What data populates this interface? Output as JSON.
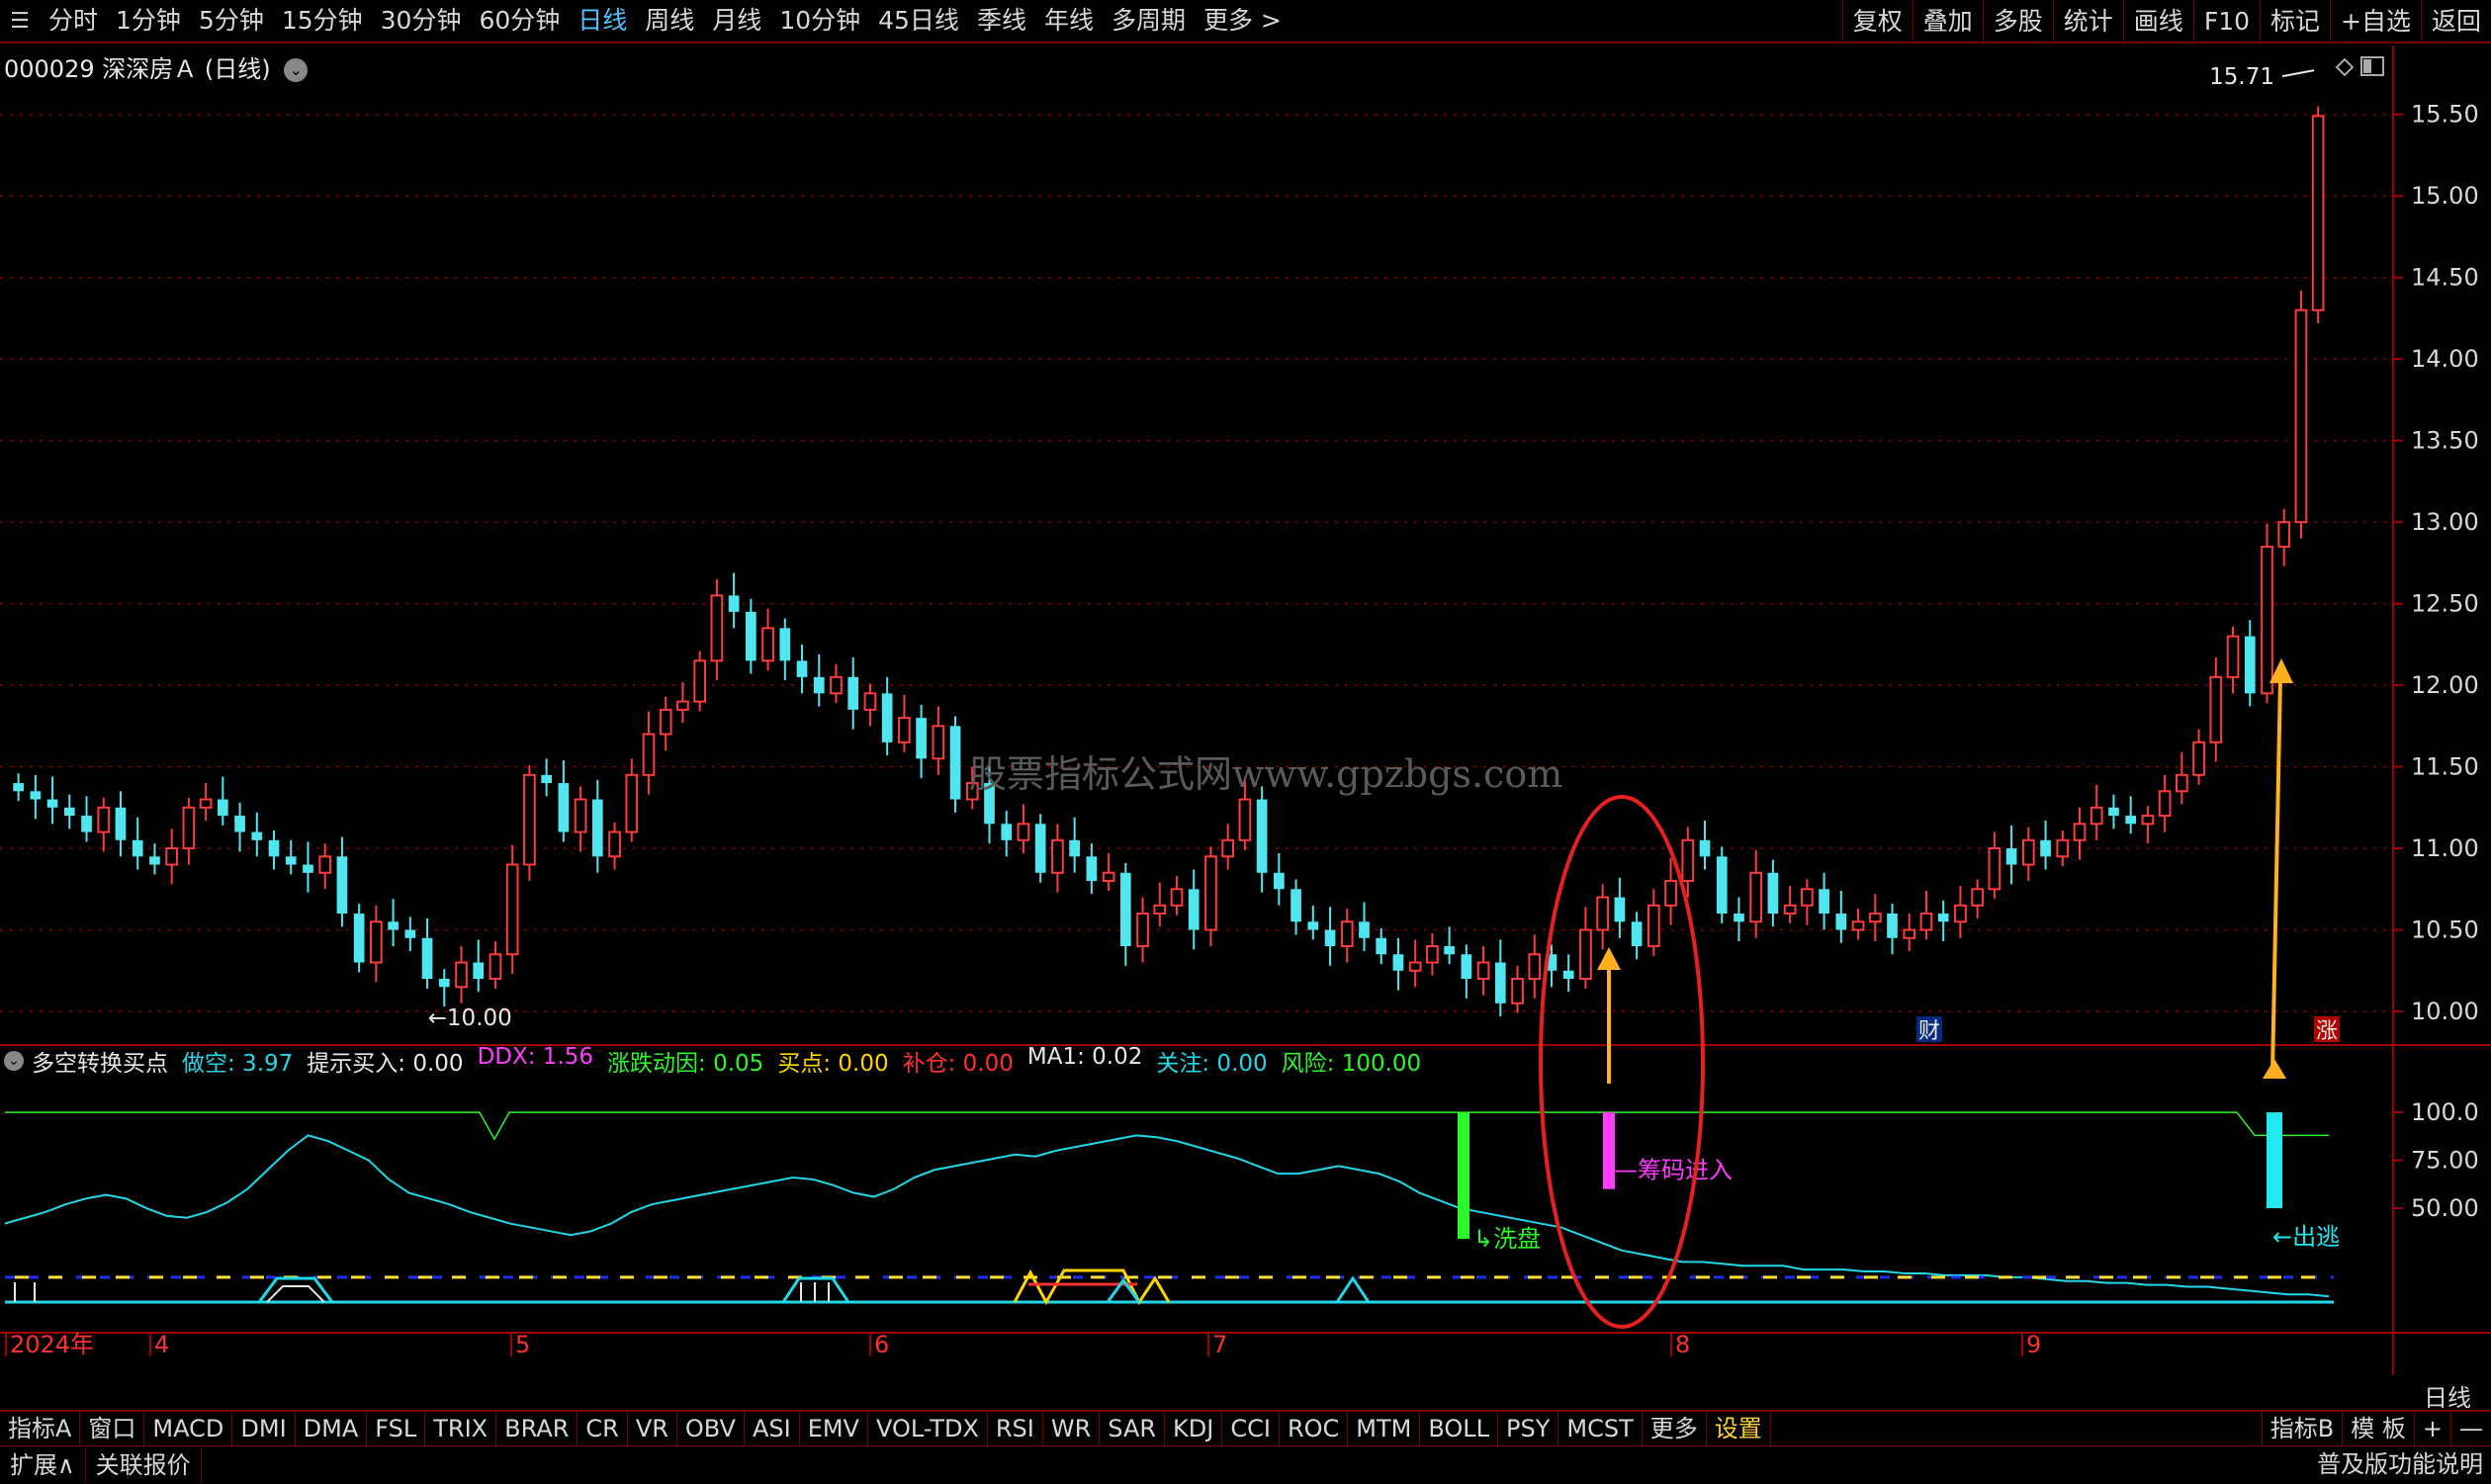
{
  "toolbar": {
    "menu_icon": "☰",
    "periods": [
      "分时",
      "1分钟",
      "5分钟",
      "15分钟",
      "30分钟",
      "60分钟",
      "日线",
      "周线",
      "月线",
      "10分钟",
      "45日线",
      "季线",
      "年线",
      "多周期",
      "更多 >"
    ],
    "active_period": "日线",
    "right_items": [
      "复权",
      "叠加",
      "多股",
      "统计",
      "画线",
      "F10",
      "标记",
      "+自选",
      "返回"
    ]
  },
  "stock": {
    "title": "000029 深深房Ａ (日线)",
    "toggle_icon": "chevron-down-icon"
  },
  "price_axis": {
    "ticks": [
      "15.50",
      "15.00",
      "14.50",
      "14.00",
      "13.50",
      "13.00",
      "12.50",
      "12.00",
      "11.50",
      "11.00",
      "10.50",
      "10.00"
    ],
    "min_label": "←10.00",
    "max_label": "15.71"
  },
  "time_axis": {
    "labels": [
      "2024年",
      "4",
      "5",
      "6",
      "7",
      "8",
      "9"
    ]
  },
  "watermark": "股票指标公式网www.gpzbgs.com",
  "event_badges": {
    "cai": "财",
    "zhang": "涨"
  },
  "indicator": {
    "name": "多空转换买点",
    "fields": [
      {
        "label": "做空:",
        "value": "3.97",
        "color": "#22d8e8"
      },
      {
        "label": "提示买入:",
        "value": "0.00",
        "color": "#e8e8e8"
      },
      {
        "label": "DDX:",
        "value": "1.56",
        "color": "#ff3cff"
      },
      {
        "label": "涨跌动因:",
        "value": "0.05",
        "color": "#2cf52c"
      },
      {
        "label": "买点:",
        "value": "0.00",
        "color": "#ffd400"
      },
      {
        "label": "补仓:",
        "value": "0.00",
        "color": "#ff3030"
      },
      {
        "label": "MA1:",
        "value": "0.02",
        "color": "#e8e8e8"
      },
      {
        "label": "关注:",
        "value": "0.00",
        "color": "#22d8e8"
      },
      {
        "label": "风险:",
        "value": "100.00",
        "color": "#2cf52c"
      }
    ],
    "axis_ticks": [
      "100.0",
      "75.00",
      "50.00"
    ],
    "annotations": {
      "washing": "洗盘",
      "chips_in": "筹码进入",
      "escape": "←出逃"
    }
  },
  "bottom_tabs": [
    "指标A",
    "窗口",
    "MACD",
    "DMI",
    "DMA",
    "FSL",
    "TRIX",
    "BRAR",
    "CR",
    "VR",
    "OBV",
    "ASI",
    "EMV",
    "VOL-TDX",
    "RSI",
    "WR",
    "SAR",
    "KDJ",
    "CCI",
    "ROC",
    "MTM",
    "BOLL",
    "PSY",
    "MCST",
    "更多",
    "设置"
  ],
  "bottom_tabs_right": [
    "指标B",
    "模 板",
    "+",
    "—"
  ],
  "period_label": "日线",
  "status": {
    "expand": "扩展∧",
    "related": "关联报价",
    "right": "普及版功能说明"
  },
  "colors": {
    "up": "#ff3c3c",
    "down": "#4fe6f0",
    "grid": "#8a0000",
    "accent": "#4fc3ff"
  },
  "chart_data": [
    {
      "type": "candlestick",
      "title": "000029 深深房Ａ (日线)",
      "ylim": [
        9.8,
        15.85
      ],
      "y_ticks": [
        10.0,
        10.5,
        11.0,
        11.5,
        12.0,
        12.5,
        13.0,
        13.5,
        14.0,
        14.5,
        15.0,
        15.5
      ],
      "min_marker": 10.0,
      "max_marker": 15.71,
      "ohlc_close": [
        11.35,
        11.3,
        11.25,
        11.2,
        11.1,
        11.25,
        11.05,
        10.95,
        10.9,
        11.0,
        11.25,
        11.3,
        11.2,
        11.1,
        11.05,
        10.95,
        10.9,
        10.85,
        10.95,
        10.6,
        10.3,
        10.55,
        10.5,
        10.45,
        10.2,
        10.15,
        10.3,
        10.2,
        10.35,
        10.9,
        11.45,
        11.4,
        11.1,
        11.3,
        10.95,
        11.1,
        11.45,
        11.7,
        11.85,
        11.9,
        12.15,
        12.55,
        12.45,
        12.15,
        12.35,
        12.15,
        12.05,
        11.95,
        12.05,
        11.85,
        11.95,
        11.65,
        11.8,
        11.55,
        11.75,
        11.3,
        11.4,
        11.15,
        11.05,
        11.15,
        10.85,
        11.05,
        10.95,
        10.8,
        10.85,
        10.4,
        10.6,
        10.65,
        10.75,
        10.5,
        10.95,
        11.05,
        11.3,
        10.85,
        10.75,
        10.55,
        10.5,
        10.4,
        10.55,
        10.45,
        10.35,
        10.25,
        10.3,
        10.4,
        10.35,
        10.2,
        10.3,
        10.05,
        10.2,
        10.35,
        10.25,
        10.2,
        10.5,
        10.7,
        10.55,
        10.4,
        10.65,
        10.8,
        11.05,
        10.95,
        10.6,
        10.55,
        10.85,
        10.6,
        10.65,
        10.75,
        10.6,
        10.5,
        10.55,
        10.6,
        10.45,
        10.5,
        10.6,
        10.55,
        10.65,
        10.75,
        11.0,
        10.9,
        11.05,
        10.95,
        11.05,
        11.15,
        11.25,
        11.2,
        11.15,
        11.2,
        11.35,
        11.45,
        11.65,
        12.05,
        12.3,
        11.95,
        12.85,
        13.0,
        14.3,
        15.49
      ]
    },
    {
      "type": "line",
      "title": "多空转换买点",
      "ylim": [
        0,
        115
      ],
      "y_ticks": [
        50,
        75,
        100
      ],
      "series": [
        {
          "name": "做空",
          "color": "#22d8e8",
          "values": [
            42,
            45,
            48,
            52,
            55,
            57,
            55,
            50,
            46,
            45,
            48,
            53,
            60,
            70,
            80,
            88,
            85,
            80,
            75,
            65,
            58,
            55,
            52,
            48,
            45,
            42,
            40,
            38,
            36,
            38,
            42,
            48,
            52,
            54,
            56,
            58,
            60,
            62,
            64,
            66,
            65,
            62,
            58,
            56,
            60,
            66,
            70,
            72,
            74,
            76,
            78,
            77,
            80,
            82,
            84,
            86,
            88,
            87,
            85,
            82,
            79,
            76,
            72,
            68,
            68,
            70,
            72,
            70,
            68,
            64,
            58,
            54,
            50,
            48,
            46,
            44,
            42,
            40,
            36,
            32,
            28,
            26,
            24,
            22,
            22,
            21,
            20,
            20,
            20,
            18,
            18,
            18,
            17,
            17,
            16,
            16,
            15,
            15,
            15,
            14,
            14,
            13,
            12,
            12,
            11,
            11,
            10,
            10,
            9,
            9,
            8,
            7,
            6,
            5,
            5,
            4
          ]
        }
      ]
    }
  ]
}
